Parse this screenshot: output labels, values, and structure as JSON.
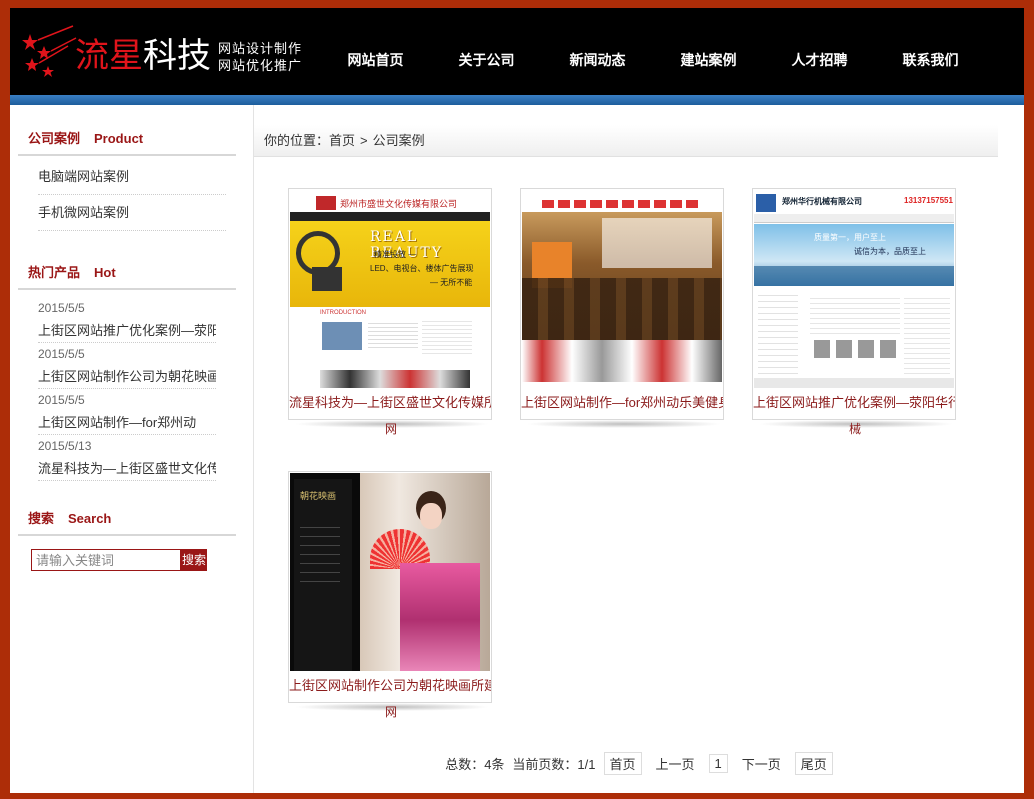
{
  "header": {
    "logo_red": "流星",
    "logo_white": "科技",
    "tagline_1": "网站设计制作",
    "tagline_2": "网站优化推广"
  },
  "nav": [
    "网站首页",
    "关于公司",
    "新闻动态",
    "建站案例",
    "人才招聘",
    "联系我们"
  ],
  "sidebar": {
    "cases_title": "公司案例",
    "cases_title_en": "Product",
    "case_links": [
      "电脑端网站案例",
      "手机微网站案例"
    ],
    "hot_title": "热门产品",
    "hot_title_en": "Hot",
    "hot_items": [
      {
        "date": "2015/5/5",
        "title": "上街区网站推广优化案例—荥阳"
      },
      {
        "date": "2015/5/5",
        "title": "上街区网站制作公司为朝花映画"
      },
      {
        "date": "2015/5/5",
        "title": "上街区网站制作—for郑州动"
      },
      {
        "date": "2015/5/13",
        "title": "流星科技为—上街区盛世文化传"
      }
    ],
    "search_title": "搜索",
    "search_title_en": "Search",
    "search_placeholder": "请输入关键词",
    "search_button": "搜索"
  },
  "breadcrumb": {
    "prefix": "你的位置：",
    "home": "首页",
    "sep": ">",
    "current": "公司案例"
  },
  "cases": [
    {
      "caption": "流星科技为—上街区盛世文化传媒所做",
      "tail": "网",
      "thumb_title": "郑州市盛世文化传媒有限公司",
      "thumb_banner": "REAL BEAUTY",
      "thumb_slogan": "精准投放 —",
      "thumb_line": "LED、电视台、楼体广告展现",
      "thumb_line2": "— 无所不能",
      "thumb_intro": "INTRODUCTION"
    },
    {
      "caption": "上街区网站制作—for郑州动乐美健身",
      "tail": ""
    },
    {
      "caption": "上街区网站推广优化案例—荥阳华行机",
      "tail": "械",
      "thumb_title": "郑州华行机械有限公司",
      "thumb_phone": "13137157551",
      "thumb_slogan": "质量第一，用户至上",
      "thumb_slogan2": "诚信为本，品质至上"
    },
    {
      "caption": "上街区网站制作公司为朝花映画所建设",
      "tail": "网",
      "thumb_logo": "朝花映画"
    }
  ],
  "pager": {
    "total": "总数：4条",
    "current": "当前页数：1/1",
    "first": "首页",
    "prev": "上一页",
    "page": "1",
    "next": "下一页",
    "last": "尾页"
  },
  "colors": {
    "frame": "#ad2d08",
    "accent": "#9a1616",
    "header_bg": "#000000",
    "header_bar": "#2a6fb5"
  }
}
